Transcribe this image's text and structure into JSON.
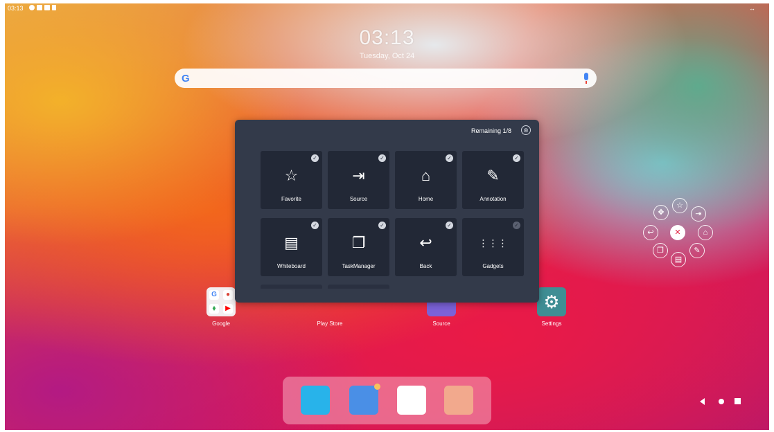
{
  "statusbar": {
    "time": "03:13",
    "right": "↔"
  },
  "clock": {
    "time": "03:13",
    "date": "Tuesday, Oct 24"
  },
  "search": {
    "logo": "G"
  },
  "panel": {
    "remaining": "Remaining 1/8",
    "close_icon": "⊗",
    "tiles": [
      {
        "label": "Favorite",
        "icon": "☆",
        "checked": true
      },
      {
        "label": "Source",
        "icon": "⇥",
        "checked": true
      },
      {
        "label": "Home",
        "icon": "⌂",
        "checked": true
      },
      {
        "label": "Annotation",
        "icon": "✎",
        "checked": true
      },
      {
        "label": "Whiteboard",
        "icon": "▤",
        "checked": true
      },
      {
        "label": "TaskManager",
        "icon": "❐",
        "checked": true
      },
      {
        "label": "Back",
        "icon": "↩",
        "checked": true
      },
      {
        "label": "Gadgets",
        "icon": "⋮⋮⋮",
        "checked": false
      }
    ],
    "check_mark": "✓"
  },
  "apps": [
    {
      "label": "Google"
    },
    {
      "label": "Play Store"
    },
    {
      "label": "Source"
    },
    {
      "label": "Settings"
    }
  ],
  "settings_icon": "⚙",
  "floating_menu": {
    "items": [
      "✥",
      "☆",
      "⇥",
      "↩",
      "✕",
      "⌂",
      "❐",
      "✎",
      "▤"
    ]
  },
  "colors": {
    "panel": "#333a4a",
    "tile": "#222836",
    "accent": "#e0203f"
  }
}
